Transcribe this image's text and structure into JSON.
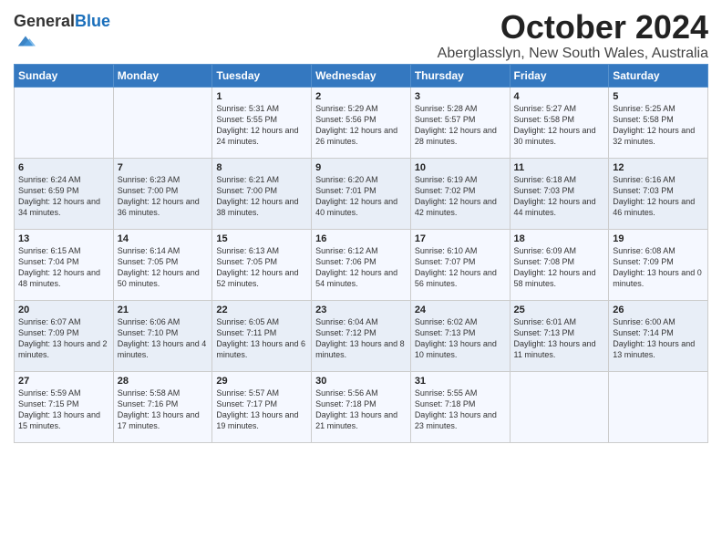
{
  "logo": {
    "general": "General",
    "blue": "Blue"
  },
  "header": {
    "month": "October 2024",
    "location": "Aberglasslyn, New South Wales, Australia"
  },
  "weekdays": [
    "Sunday",
    "Monday",
    "Tuesday",
    "Wednesday",
    "Thursday",
    "Friday",
    "Saturday"
  ],
  "weeks": [
    [
      {
        "day": "",
        "sunrise": "",
        "sunset": "",
        "daylight": ""
      },
      {
        "day": "",
        "sunrise": "",
        "sunset": "",
        "daylight": ""
      },
      {
        "day": "1",
        "sunrise": "Sunrise: 5:31 AM",
        "sunset": "Sunset: 5:55 PM",
        "daylight": "Daylight: 12 hours and 24 minutes."
      },
      {
        "day": "2",
        "sunrise": "Sunrise: 5:29 AM",
        "sunset": "Sunset: 5:56 PM",
        "daylight": "Daylight: 12 hours and 26 minutes."
      },
      {
        "day": "3",
        "sunrise": "Sunrise: 5:28 AM",
        "sunset": "Sunset: 5:57 PM",
        "daylight": "Daylight: 12 hours and 28 minutes."
      },
      {
        "day": "4",
        "sunrise": "Sunrise: 5:27 AM",
        "sunset": "Sunset: 5:58 PM",
        "daylight": "Daylight: 12 hours and 30 minutes."
      },
      {
        "day": "5",
        "sunrise": "Sunrise: 5:25 AM",
        "sunset": "Sunset: 5:58 PM",
        "daylight": "Daylight: 12 hours and 32 minutes."
      }
    ],
    [
      {
        "day": "6",
        "sunrise": "Sunrise: 6:24 AM",
        "sunset": "Sunset: 6:59 PM",
        "daylight": "Daylight: 12 hours and 34 minutes."
      },
      {
        "day": "7",
        "sunrise": "Sunrise: 6:23 AM",
        "sunset": "Sunset: 7:00 PM",
        "daylight": "Daylight: 12 hours and 36 minutes."
      },
      {
        "day": "8",
        "sunrise": "Sunrise: 6:21 AM",
        "sunset": "Sunset: 7:00 PM",
        "daylight": "Daylight: 12 hours and 38 minutes."
      },
      {
        "day": "9",
        "sunrise": "Sunrise: 6:20 AM",
        "sunset": "Sunset: 7:01 PM",
        "daylight": "Daylight: 12 hours and 40 minutes."
      },
      {
        "day": "10",
        "sunrise": "Sunrise: 6:19 AM",
        "sunset": "Sunset: 7:02 PM",
        "daylight": "Daylight: 12 hours and 42 minutes."
      },
      {
        "day": "11",
        "sunrise": "Sunrise: 6:18 AM",
        "sunset": "Sunset: 7:03 PM",
        "daylight": "Daylight: 12 hours and 44 minutes."
      },
      {
        "day": "12",
        "sunrise": "Sunrise: 6:16 AM",
        "sunset": "Sunset: 7:03 PM",
        "daylight": "Daylight: 12 hours and 46 minutes."
      }
    ],
    [
      {
        "day": "13",
        "sunrise": "Sunrise: 6:15 AM",
        "sunset": "Sunset: 7:04 PM",
        "daylight": "Daylight: 12 hours and 48 minutes."
      },
      {
        "day": "14",
        "sunrise": "Sunrise: 6:14 AM",
        "sunset": "Sunset: 7:05 PM",
        "daylight": "Daylight: 12 hours and 50 minutes."
      },
      {
        "day": "15",
        "sunrise": "Sunrise: 6:13 AM",
        "sunset": "Sunset: 7:05 PM",
        "daylight": "Daylight: 12 hours and 52 minutes."
      },
      {
        "day": "16",
        "sunrise": "Sunrise: 6:12 AM",
        "sunset": "Sunset: 7:06 PM",
        "daylight": "Daylight: 12 hours and 54 minutes."
      },
      {
        "day": "17",
        "sunrise": "Sunrise: 6:10 AM",
        "sunset": "Sunset: 7:07 PM",
        "daylight": "Daylight: 12 hours and 56 minutes."
      },
      {
        "day": "18",
        "sunrise": "Sunrise: 6:09 AM",
        "sunset": "Sunset: 7:08 PM",
        "daylight": "Daylight: 12 hours and 58 minutes."
      },
      {
        "day": "19",
        "sunrise": "Sunrise: 6:08 AM",
        "sunset": "Sunset: 7:09 PM",
        "daylight": "Daylight: 13 hours and 0 minutes."
      }
    ],
    [
      {
        "day": "20",
        "sunrise": "Sunrise: 6:07 AM",
        "sunset": "Sunset: 7:09 PM",
        "daylight": "Daylight: 13 hours and 2 minutes."
      },
      {
        "day": "21",
        "sunrise": "Sunrise: 6:06 AM",
        "sunset": "Sunset: 7:10 PM",
        "daylight": "Daylight: 13 hours and 4 minutes."
      },
      {
        "day": "22",
        "sunrise": "Sunrise: 6:05 AM",
        "sunset": "Sunset: 7:11 PM",
        "daylight": "Daylight: 13 hours and 6 minutes."
      },
      {
        "day": "23",
        "sunrise": "Sunrise: 6:04 AM",
        "sunset": "Sunset: 7:12 PM",
        "daylight": "Daylight: 13 hours and 8 minutes."
      },
      {
        "day": "24",
        "sunrise": "Sunrise: 6:02 AM",
        "sunset": "Sunset: 7:13 PM",
        "daylight": "Daylight: 13 hours and 10 minutes."
      },
      {
        "day": "25",
        "sunrise": "Sunrise: 6:01 AM",
        "sunset": "Sunset: 7:13 PM",
        "daylight": "Daylight: 13 hours and 11 minutes."
      },
      {
        "day": "26",
        "sunrise": "Sunrise: 6:00 AM",
        "sunset": "Sunset: 7:14 PM",
        "daylight": "Daylight: 13 hours and 13 minutes."
      }
    ],
    [
      {
        "day": "27",
        "sunrise": "Sunrise: 5:59 AM",
        "sunset": "Sunset: 7:15 PM",
        "daylight": "Daylight: 13 hours and 15 minutes."
      },
      {
        "day": "28",
        "sunrise": "Sunrise: 5:58 AM",
        "sunset": "Sunset: 7:16 PM",
        "daylight": "Daylight: 13 hours and 17 minutes."
      },
      {
        "day": "29",
        "sunrise": "Sunrise: 5:57 AM",
        "sunset": "Sunset: 7:17 PM",
        "daylight": "Daylight: 13 hours and 19 minutes."
      },
      {
        "day": "30",
        "sunrise": "Sunrise: 5:56 AM",
        "sunset": "Sunset: 7:18 PM",
        "daylight": "Daylight: 13 hours and 21 minutes."
      },
      {
        "day": "31",
        "sunrise": "Sunrise: 5:55 AM",
        "sunset": "Sunset: 7:18 PM",
        "daylight": "Daylight: 13 hours and 23 minutes."
      },
      {
        "day": "",
        "sunrise": "",
        "sunset": "",
        "daylight": ""
      },
      {
        "day": "",
        "sunrise": "",
        "sunset": "",
        "daylight": ""
      }
    ]
  ]
}
